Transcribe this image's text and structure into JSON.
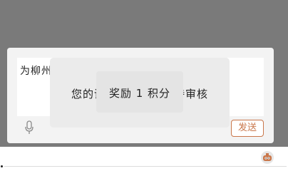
{
  "comment_box": {
    "input_text": "为柳州",
    "send_label": "发送"
  },
  "toast": {
    "message": "您的评论已提交，等待审核",
    "reward_text": "奖励 1 积分"
  },
  "icons": {
    "mic": "microphone-icon",
    "robot": "robot-icon"
  },
  "colors": {
    "send_accent": "#c9764a",
    "overlay": "#7a7a7a"
  }
}
